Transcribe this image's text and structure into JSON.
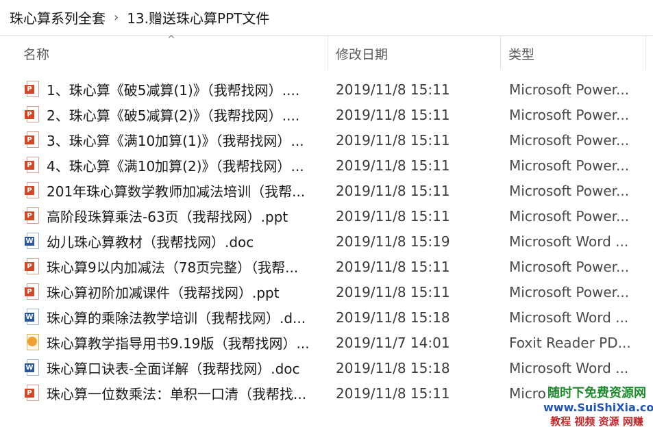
{
  "breadcrumb": {
    "parent": "珠心算系列全套",
    "current": "13.赠送珠心算PPT文件"
  },
  "columns": {
    "name": "名称",
    "date": "修改日期",
    "type": "类型"
  },
  "files": [
    {
      "name": "1、珠心算《破5减算(1)》（我帮找网）....",
      "date": "2019/11/8 15:11",
      "type": "Microsoft Power...",
      "icon": "ppt-file-icon"
    },
    {
      "name": "2、珠心算《破5减算(2)》（我帮找网）....",
      "date": "2019/11/8 15:11",
      "type": "Microsoft Power...",
      "icon": "ppt-file-icon"
    },
    {
      "name": "3、珠心算《满10加算(1)》（我帮找网）...",
      "date": "2019/11/8 15:11",
      "type": "Microsoft Power...",
      "icon": "ppt-file-icon"
    },
    {
      "name": "4、珠心算《满10加算(2)》（我帮找网）...",
      "date": "2019/11/8 15:11",
      "type": "Microsoft Power...",
      "icon": "ppt-file-icon"
    },
    {
      "name": "201年珠心算数学教师加减法培训（我帮...",
      "date": "2019/11/8 15:11",
      "type": "Microsoft Power...",
      "icon": "ppt-file-icon"
    },
    {
      "name": "高阶段珠算乘法-63页（我帮找网）.ppt",
      "date": "2019/11/8 15:11",
      "type": "Microsoft Power...",
      "icon": "ppt-file-icon"
    },
    {
      "name": "幼儿珠心算教材（我帮找网）.doc",
      "date": "2019/11/8 15:19",
      "type": "Microsoft Word ...",
      "icon": "word-file-icon"
    },
    {
      "name": "珠心算9以内加减法（78页完整）（我帮...",
      "date": "2019/11/8 15:11",
      "type": "Microsoft Power...",
      "icon": "ppt-file-icon"
    },
    {
      "name": "珠心算初阶加减课件（我帮找网）.ppt",
      "date": "2019/11/8 15:11",
      "type": "Microsoft Power...",
      "icon": "ppt-file-icon"
    },
    {
      "name": "珠心算的乘除法教学培训（我帮找网）.d...",
      "date": "2019/11/8 15:18",
      "type": "Microsoft Word ...",
      "icon": "word-file-icon"
    },
    {
      "name": "珠心算教学指导用书9.19版（我帮找网）...",
      "date": "2019/11/7 14:01",
      "type": "Foxit Reader PD...",
      "icon": "pdf-file-icon"
    },
    {
      "name": "珠心算口诀表-全面详解（我帮找网）.doc",
      "date": "2019/11/8 15:18",
      "type": "Microsoft Word ...",
      "icon": "word-file-icon"
    },
    {
      "name": "珠心算一位数乘法：单积一口清（我帮找...",
      "date": "2019/11/8 15:11",
      "type": "Micro",
      "icon": "ppt-file-icon"
    }
  ],
  "watermark": {
    "line1": "随时下免费资源网",
    "line2": "www.SuiShiXia.com",
    "line3": "教程 视频 资源 网赚"
  }
}
